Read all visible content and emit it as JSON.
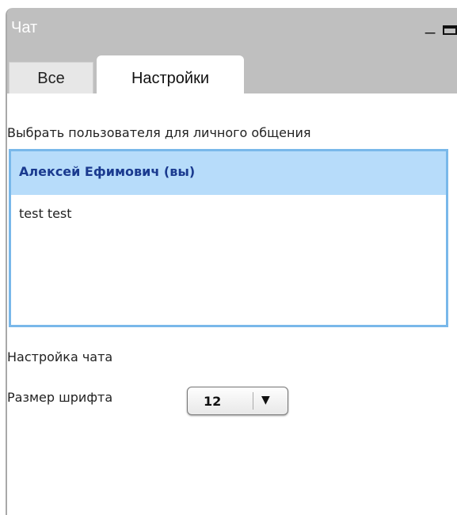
{
  "window": {
    "title": "Чат",
    "minimize_glyph": "_",
    "maximize_icon": "maximize-icon"
  },
  "tabs": [
    {
      "label": "Все",
      "active": false
    },
    {
      "label": "Настройки",
      "active": true
    }
  ],
  "settings": {
    "users_section_label": "Выбрать пользователя для личного общения",
    "users": [
      {
        "name": "Алексей Ефимович (вы)",
        "selected": true
      },
      {
        "name": "test test",
        "selected": false
      }
    ],
    "chat_settings_label": "Настройка чата",
    "font_size": {
      "label": "Размер шрифта",
      "value": "12",
      "arrow": "▼"
    }
  },
  "colors": {
    "titlebar": "#bfbfbf",
    "selected_row": "#b7dcfa",
    "selected_text": "#1a3a8f",
    "list_border": "#79b8ea"
  }
}
